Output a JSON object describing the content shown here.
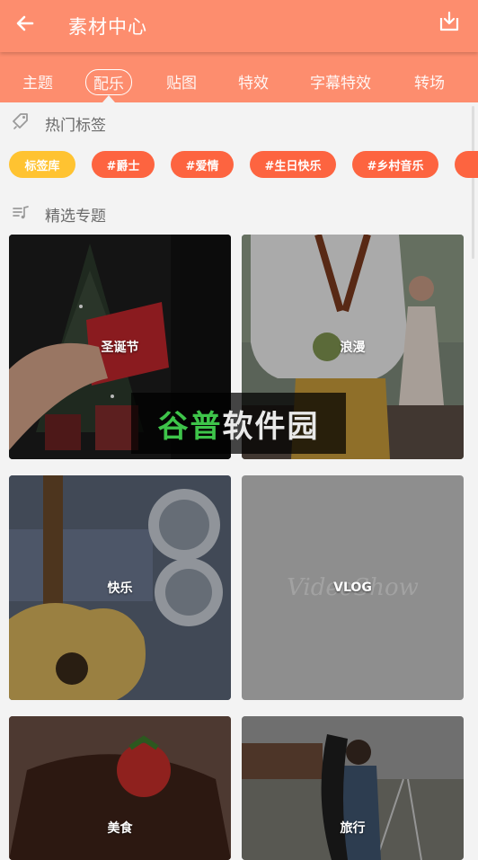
{
  "header": {
    "title": "素材中心"
  },
  "tabs": [
    {
      "label": "主题",
      "active": false
    },
    {
      "label": "配乐",
      "active": true
    },
    {
      "label": "贴图",
      "active": false
    },
    {
      "label": "特效",
      "active": false
    },
    {
      "label": "字幕特效",
      "active": false
    },
    {
      "label": "转场",
      "active": false
    }
  ],
  "hot_tags": {
    "title": "热门标签",
    "items": [
      "标签库",
      "#爵士",
      "#爱情",
      "#生日快乐",
      "#乡村音乐"
    ]
  },
  "featured": {
    "title": "精选专题",
    "cards": [
      {
        "label": "圣诞节"
      },
      {
        "label": "浪漫"
      },
      {
        "label": "快乐"
      },
      {
        "label": "VLOG",
        "placeholder": "VideoShow"
      },
      {
        "label": "美食"
      },
      {
        "label": "旅行"
      }
    ]
  },
  "watermark": {
    "part1": "谷普",
    "part2": "软件园"
  },
  "colors": {
    "header": "#fd8d6e",
    "tag": "#fd6440",
    "tag_library": "#ffc331"
  }
}
